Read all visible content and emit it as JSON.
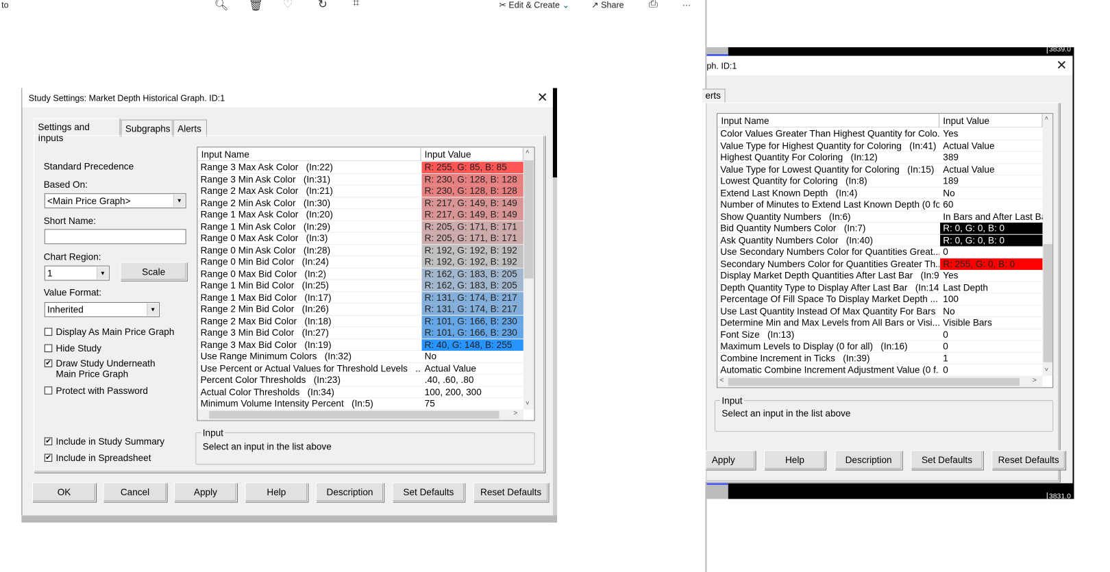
{
  "viewer_toolbar": {
    "left_text": "to",
    "edit_create": "Edit & Create",
    "share": "Share",
    "more": "···",
    "icons": [
      "zoom-in-icon",
      "delete-icon",
      "heart-icon",
      "rotate-icon",
      "crop-icon",
      "edit-create-icon",
      "share-icon",
      "print-icon",
      "more-icon"
    ]
  },
  "chart_bg": {
    "price_top": "3839.0",
    "price_bottom": "3831.0"
  },
  "left_dialog": {
    "title": "Study Settings: Market Depth Historical Graph. ID:1",
    "tabs": [
      "Settings and Inputs",
      "Subgraphs",
      "Alerts"
    ],
    "standard_precedence": "Standard Precedence",
    "based_on_label": "Based On:",
    "based_on_value": "<Main Price Graph>",
    "short_name_label": "Short Name:",
    "short_name_value": "",
    "chart_region_label": "Chart Region:",
    "chart_region_value": "1",
    "scale_button": "Scale",
    "value_format_label": "Value Format:",
    "value_format_value": "Inherited",
    "checkboxes": [
      {
        "label": "Display As Main Price Graph",
        "checked": false
      },
      {
        "label": "Hide Study",
        "checked": false
      },
      {
        "label": "Draw Study Underneath",
        "label2": "Main Price Graph",
        "checked": true
      },
      {
        "label": "Protect with Password",
        "checked": false
      },
      {
        "label": "Include in Study Summary",
        "checked": true
      },
      {
        "label": "Include in Spreadsheet",
        "checked": true
      }
    ],
    "table": {
      "headers": [
        "Input Name",
        "Input Value"
      ],
      "rows": [
        {
          "name": "Range 3 Max Ask Color   (In:22)",
          "value": "R: 255, G: 85, B: 85",
          "color": "#ff5555"
        },
        {
          "name": "Range 3 Min Ask Color   (In:31)",
          "value": "R: 230, G: 128, B: 128",
          "color": "#e68080"
        },
        {
          "name": "Range 2 Max Ask Color   (In:21)",
          "value": "R: 230, G: 128, B: 128",
          "color": "#e68080"
        },
        {
          "name": "Range 2 Min Ask Color   (In:30)",
          "value": "R: 217, G: 149, B: 149",
          "color": "#d99595"
        },
        {
          "name": "Range 1 Max Ask Color   (In:20)",
          "value": "R: 217, G: 149, B: 149",
          "color": "#d99595"
        },
        {
          "name": "Range 1 Min Ask Color   (In:29)",
          "value": "R: 205, G: 171, B: 171",
          "color": "#cdabab"
        },
        {
          "name": "Range 0 Max Ask Color   (In:3)",
          "value": "R: 205, G: 171, B: 171",
          "color": "#cdabab"
        },
        {
          "name": "Range 0 Min Ask Color   (In:28)",
          "value": "R: 192, G: 192, B: 192",
          "color": "#c0c0c0"
        },
        {
          "name": "Range 0 Min Bid Color   (In:24)",
          "value": "R: 192, G: 192, B: 192",
          "color": "#c0c0c0"
        },
        {
          "name": "Range 0 Max Bid Color   (In:2)",
          "value": "R: 162, G: 183, B: 205",
          "color": "#a2b7cd"
        },
        {
          "name": "Range 1 Min Bid Color   (In:25)",
          "value": "R: 162, G: 183, B: 205",
          "color": "#a2b7cd"
        },
        {
          "name": "Range 1 Max Bid Color   (In:17)",
          "value": "R: 131, G: 174, B: 217",
          "color": "#83aed9"
        },
        {
          "name": "Range 2 Min Bid Color   (In:26)",
          "value": "R: 131, G: 174, B: 217",
          "color": "#83aed9"
        },
        {
          "name": "Range 2 Max Bid Color   (In:18)",
          "value": "R: 101, G: 166, B: 230",
          "color": "#65a6e6"
        },
        {
          "name": "Range 3 Min Bid Color   (In:27)",
          "value": "R: 101, G: 166, B: 230",
          "color": "#65a6e6"
        },
        {
          "name": "Range 3 Max Bid Color   (In:19)",
          "value": "R: 40, G: 148, B: 255",
          "color": "#2894ff"
        },
        {
          "name": "Use Range Minimum Colors   (In:32)",
          "value": "No"
        },
        {
          "name": "Use Percent or Actual Values for Threshold Levels   ...",
          "value": "Actual Value"
        },
        {
          "name": "Percent Color Thresholds   (In:23)",
          "value": ".40, .60, .80"
        },
        {
          "name": "Actual Color Thresholds   (In:34)",
          "value": "100, 200, 300"
        },
        {
          "name": "Minimum Volume Intensity Percent   (In:5)",
          "value": "75"
        }
      ]
    },
    "input_group": {
      "label": "Input",
      "text": "Select an input in the list above"
    },
    "buttons": [
      "OK",
      "Cancel",
      "Apply",
      "Help",
      "Description",
      "Set Defaults",
      "Reset Defaults"
    ]
  },
  "right_dialog": {
    "title": "ph. ID:1",
    "tab": "erts",
    "table": {
      "headers": [
        "Input Name",
        "Input Value"
      ],
      "rows": [
        {
          "name": "Color Values Greater Than Highest Quantity for Colo...",
          "value": "Yes"
        },
        {
          "name": "Value Type for Highest Quantity for Coloring   (In:41)",
          "value": "Actual Value"
        },
        {
          "name": "Highest Quantity For Coloring   (In:12)",
          "value": "389"
        },
        {
          "name": "Value Type for Lowest Quantity for Coloring   (In:15)",
          "value": "Actual Value"
        },
        {
          "name": "Lowest Quantity for Coloring   (In:8)",
          "value": "189"
        },
        {
          "name": "Extend Last Known Depth   (In:4)",
          "value": "No"
        },
        {
          "name": "Number of Minutes to Extend Last Known Depth (0 fo...",
          "value": "60"
        },
        {
          "name": "Show Quantity Numbers   (In:6)",
          "value": "In Bars and After Last Ba"
        },
        {
          "name": "Bid Quantity Numbers Color   (In:7)",
          "value": "R: 0, G: 0, B: 0",
          "color": "#000000"
        },
        {
          "name": "Ask Quantity Numbers Color   (In:40)",
          "value": "R: 0, G: 0, B: 0",
          "color": "#000000"
        },
        {
          "name": "Use Secondary Numbers Color for Quantities Great...",
          "value": "0"
        },
        {
          "name": "Secondary Numbers Color for Quantities Greater Th...",
          "value": "R: 255, G: 0, B: 0",
          "color": "#ff0000"
        },
        {
          "name": "Display Market Depth Quantities After Last Bar   (In:9)",
          "value": "Yes"
        },
        {
          "name": "Depth Quantity Type to Display After Last Bar   (In:14)",
          "value": "Last Depth"
        },
        {
          "name": "Percentage Of Fill Space To Display Market Depth ...",
          "value": "100"
        },
        {
          "name": "Use Last Quantity Instead Of Max Quantity For Bars  ...",
          "value": "No"
        },
        {
          "name": "Determine Min and Max Levels from All Bars or Visi...",
          "value": "Visible Bars"
        },
        {
          "name": "Font Size   (In:13)",
          "value": "0"
        },
        {
          "name": "Maximum Levels to Display (0 for all)   (In:16)",
          "value": "0"
        },
        {
          "name": "Combine Increment in Ticks   (In:39)",
          "value": "1"
        },
        {
          "name": "Automatic Combine Increment Adjustment Value (0 f...",
          "value": "0"
        }
      ]
    },
    "input_group": {
      "label": "Input",
      "text": "Select an input in the list above"
    },
    "buttons": [
      "Apply",
      "Help",
      "Description",
      "Set Defaults",
      "Reset Defaults"
    ]
  }
}
